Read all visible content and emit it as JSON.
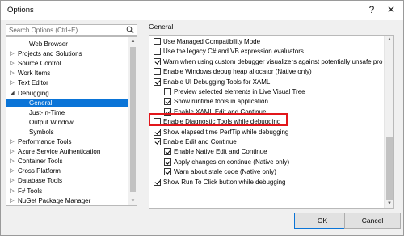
{
  "window": {
    "title": "Options",
    "help": "?",
    "close": "✕"
  },
  "search": {
    "placeholder": "Search Options (Ctrl+E)",
    "value": ""
  },
  "tree": {
    "items": [
      {
        "label": "Web Browser",
        "level": 2,
        "arrow": ""
      },
      {
        "label": "Projects and Solutions",
        "level": 1,
        "arrow": "▷"
      },
      {
        "label": "Source Control",
        "level": 1,
        "arrow": "▷"
      },
      {
        "label": "Work Items",
        "level": 1,
        "arrow": "▷"
      },
      {
        "label": "Text Editor",
        "level": 1,
        "arrow": "▷"
      },
      {
        "label": "Debugging",
        "level": 1,
        "arrow": "◢"
      },
      {
        "label": "General",
        "level": 2,
        "arrow": "",
        "selected": true
      },
      {
        "label": "Just-In-Time",
        "level": 2,
        "arrow": ""
      },
      {
        "label": "Output Window",
        "level": 2,
        "arrow": ""
      },
      {
        "label": "Symbols",
        "level": 2,
        "arrow": ""
      },
      {
        "label": "Performance Tools",
        "level": 1,
        "arrow": "▷"
      },
      {
        "label": "Azure Service Authentication",
        "level": 1,
        "arrow": "▷"
      },
      {
        "label": "Container Tools",
        "level": 1,
        "arrow": "▷"
      },
      {
        "label": "Cross Platform",
        "level": 1,
        "arrow": "▷"
      },
      {
        "label": "Database Tools",
        "level": 1,
        "arrow": "▷"
      },
      {
        "label": "F# Tools",
        "level": 1,
        "arrow": "▷"
      },
      {
        "label": "NuGet Package Manager",
        "level": 1,
        "arrow": "▷"
      }
    ]
  },
  "panel": {
    "title": "General",
    "options": [
      {
        "label": "Use Managed Compatibility Mode",
        "checked": false,
        "indent": 0
      },
      {
        "label": "Use the legacy C# and VB expression evaluators",
        "checked": false,
        "indent": 0
      },
      {
        "label": "Warn when using custom debugger visualizers against potentially unsafe pro",
        "checked": true,
        "indent": 0
      },
      {
        "label": "Enable Windows debug heap allocator (Native only)",
        "checked": false,
        "indent": 0
      },
      {
        "label": "Enable UI Debugging Tools for XAML",
        "checked": true,
        "indent": 0
      },
      {
        "label": "Preview selected elements in Live Visual Tree",
        "checked": false,
        "indent": 1
      },
      {
        "label": "Show runtime tools in application",
        "checked": true,
        "indent": 1
      },
      {
        "label": "Enable XAML Edit and Continue",
        "checked": true,
        "indent": 1
      },
      {
        "label": "Enable Diagnostic Tools while debugging",
        "checked": false,
        "indent": 0
      },
      {
        "label": "Show elapsed time PerfTip while debugging",
        "checked": true,
        "indent": 0
      },
      {
        "label": "Enable Edit and Continue",
        "checked": true,
        "indent": 0
      },
      {
        "label": "Enable Native Edit and Continue",
        "checked": true,
        "indent": 1
      },
      {
        "label": "Apply changes on continue (Native only)",
        "checked": true,
        "indent": 1
      },
      {
        "label": "Warn about stale code (Native only)",
        "checked": true,
        "indent": 1
      },
      {
        "label": "Show Run To Click button while debugging",
        "checked": true,
        "indent": 0
      }
    ]
  },
  "buttons": {
    "ok": "OK",
    "cancel": "Cancel"
  },
  "colors": {
    "selection": "#0a74d7",
    "highlight": "#e2161b"
  }
}
